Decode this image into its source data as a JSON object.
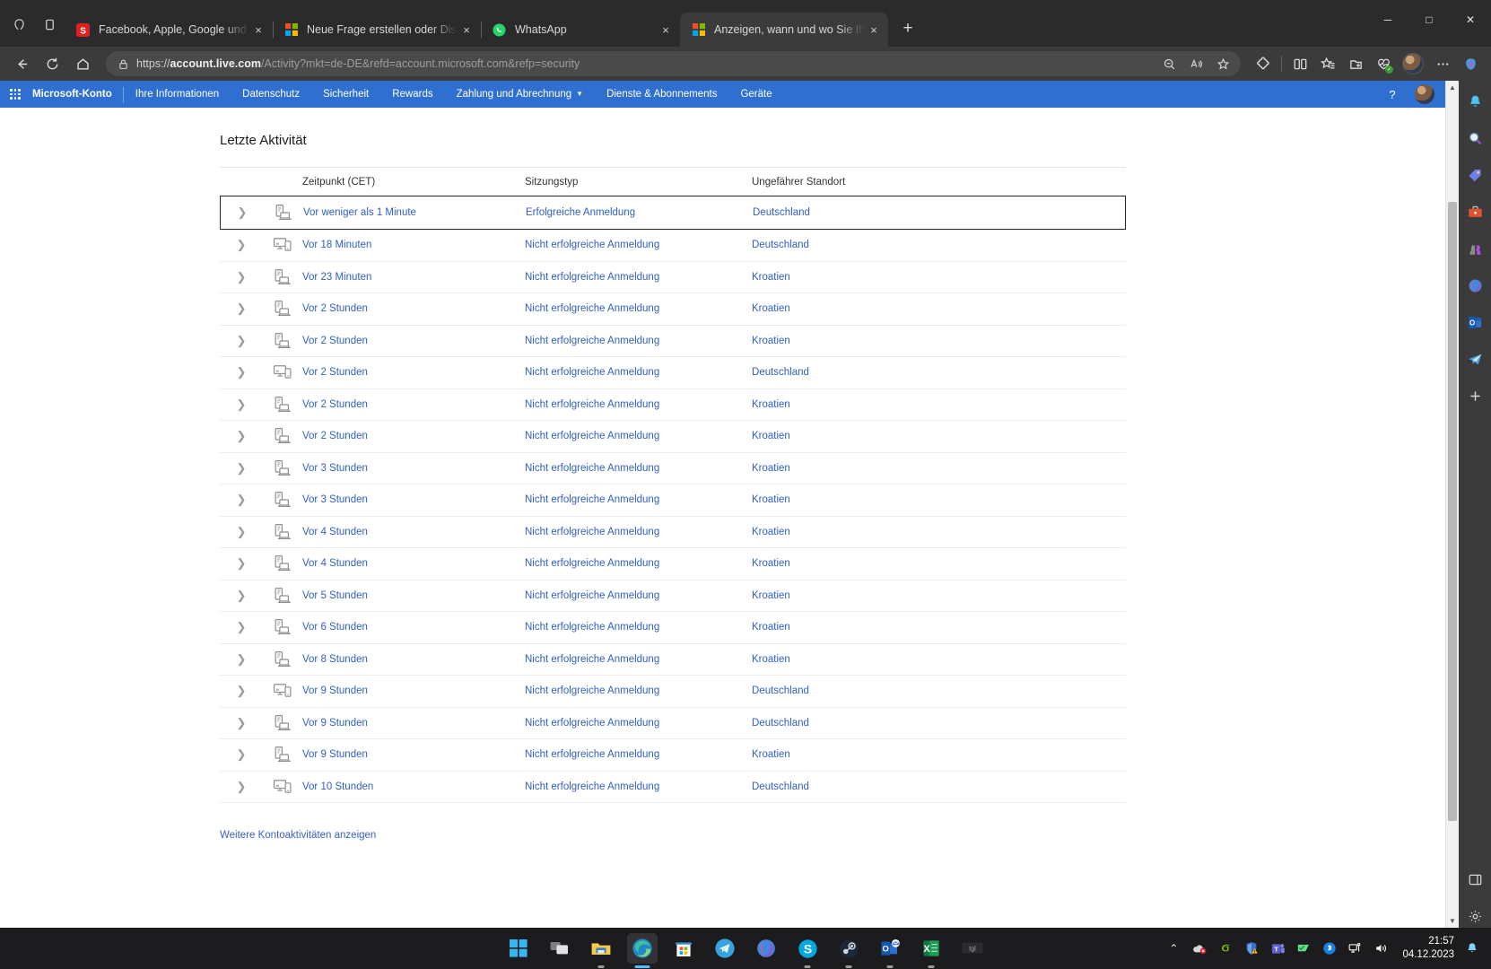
{
  "browser": {
    "tabs": [
      {
        "title": "Facebook, Apple, Google und Co",
        "favicon": "facebook-rss-icon",
        "active": false
      },
      {
        "title": "Neue Frage erstellen oder Diskus",
        "favicon": "microsoft-icon",
        "active": false
      },
      {
        "title": "WhatsApp",
        "favicon": "whatsapp-icon",
        "active": false
      },
      {
        "title": "Anzeigen, wann und wo Sie Ihr K",
        "favicon": "microsoft-icon",
        "active": true
      }
    ],
    "new_tab_label": "+",
    "close_label": "×",
    "window_controls": {
      "minimize": "─",
      "maximize": "□",
      "close": "✕"
    },
    "url": {
      "scheme": "https://",
      "domain": "account.live.com",
      "path": "/Activity?mkt=de-DE&refd=account.microsoft.com&refp=security",
      "full": "https://account.live.com/Activity?mkt=de-DE&refd=account.microsoft.com&refp=security"
    },
    "nav_icons": [
      "back-icon",
      "refresh-icon",
      "home-icon"
    ],
    "omnibox_icons": [
      "zoom-out-icon",
      "read-aloud-icon",
      "favorite-star-icon"
    ],
    "toolbar_icons": [
      "extensions-icon",
      "split-screen-icon",
      "favorites-icon",
      "collections-add-icon",
      "browser-essentials-icon",
      "profile-avatar",
      "settings-more-icon",
      "copilot-icon"
    ]
  },
  "rail": {
    "items": [
      {
        "name": "notifications-bell-icon",
        "glyph": "🔔"
      },
      {
        "name": "search-icon",
        "glyph": "🔍"
      },
      {
        "name": "shopping-tag-icon",
        "glyph": "🏷"
      },
      {
        "name": "tools-briefcase-icon",
        "glyph": "🧰"
      },
      {
        "name": "games-icon",
        "glyph": "♟"
      },
      {
        "name": "microsoft-365-icon",
        "glyph": "◐"
      },
      {
        "name": "outlook-icon",
        "glyph": "✉"
      },
      {
        "name": "telegram-icon",
        "glyph": "✈"
      },
      {
        "name": "add-sidebar-icon",
        "glyph": "＋"
      },
      {
        "name": "sidebar-toggle-icon",
        "glyph": "▣"
      },
      {
        "name": "sidebar-settings-icon",
        "glyph": "⚙"
      }
    ]
  },
  "msnav": {
    "brand": "Microsoft-Konto",
    "items": [
      {
        "label": "Ihre Informationen",
        "has_caret": false
      },
      {
        "label": "Datenschutz",
        "has_caret": false
      },
      {
        "label": "Sicherheit",
        "has_caret": false
      },
      {
        "label": "Rewards",
        "has_caret": false
      },
      {
        "label": "Zahlung und Abrechnung",
        "has_caret": true
      },
      {
        "label": "Dienste & Abonnements",
        "has_caret": false
      },
      {
        "label": "Geräte",
        "has_caret": false
      }
    ],
    "help_label": "?",
    "accent_color": "#2f6fd0"
  },
  "main": {
    "section_title": "Letzte Aktivität",
    "columns": [
      "Zeitpunkt (CET)",
      "Sitzungstyp",
      "Ungefährer Standort"
    ],
    "more_link": "Weitere Kontoaktivitäten anzeigen",
    "link_color": "#2f5fc4",
    "rows": [
      {
        "time": "Vor weniger als 1 Minute",
        "type": "Erfolgreiche Anmeldung",
        "location": "Deutschland",
        "device": "desktop-laptop-icon",
        "selected": true
      },
      {
        "time": "Vor 18 Minuten",
        "type": "Nicht erfolgreiche Anmeldung",
        "location": "Deutschland",
        "device": "monitor-phone-icon",
        "selected": false
      },
      {
        "time": "Vor 23 Minuten",
        "type": "Nicht erfolgreiche Anmeldung",
        "location": "Kroatien",
        "device": "desktop-laptop-icon",
        "selected": false
      },
      {
        "time": "Vor 2 Stunden",
        "type": "Nicht erfolgreiche Anmeldung",
        "location": "Kroatien",
        "device": "desktop-laptop-icon",
        "selected": false
      },
      {
        "time": "Vor 2 Stunden",
        "type": "Nicht erfolgreiche Anmeldung",
        "location": "Kroatien",
        "device": "desktop-laptop-icon",
        "selected": false
      },
      {
        "time": "Vor 2 Stunden",
        "type": "Nicht erfolgreiche Anmeldung",
        "location": "Deutschland",
        "device": "monitor-phone-icon",
        "selected": false
      },
      {
        "time": "Vor 2 Stunden",
        "type": "Nicht erfolgreiche Anmeldung",
        "location": "Kroatien",
        "device": "desktop-laptop-icon",
        "selected": false
      },
      {
        "time": "Vor 2 Stunden",
        "type": "Nicht erfolgreiche Anmeldung",
        "location": "Kroatien",
        "device": "desktop-laptop-icon",
        "selected": false
      },
      {
        "time": "Vor 3 Stunden",
        "type": "Nicht erfolgreiche Anmeldung",
        "location": "Kroatien",
        "device": "desktop-laptop-icon",
        "selected": false
      },
      {
        "time": "Vor 3 Stunden",
        "type": "Nicht erfolgreiche Anmeldung",
        "location": "Kroatien",
        "device": "desktop-laptop-icon",
        "selected": false
      },
      {
        "time": "Vor 4 Stunden",
        "type": "Nicht erfolgreiche Anmeldung",
        "location": "Kroatien",
        "device": "desktop-laptop-icon",
        "selected": false
      },
      {
        "time": "Vor 4 Stunden",
        "type": "Nicht erfolgreiche Anmeldung",
        "location": "Kroatien",
        "device": "desktop-laptop-icon",
        "selected": false
      },
      {
        "time": "Vor 5 Stunden",
        "type": "Nicht erfolgreiche Anmeldung",
        "location": "Kroatien",
        "device": "desktop-laptop-icon",
        "selected": false
      },
      {
        "time": "Vor 6 Stunden",
        "type": "Nicht erfolgreiche Anmeldung",
        "location": "Kroatien",
        "device": "desktop-laptop-icon",
        "selected": false
      },
      {
        "time": "Vor 8 Stunden",
        "type": "Nicht erfolgreiche Anmeldung",
        "location": "Kroatien",
        "device": "desktop-laptop-icon",
        "selected": false
      },
      {
        "time": "Vor 9 Stunden",
        "type": "Nicht erfolgreiche Anmeldung",
        "location": "Deutschland",
        "device": "monitor-phone-icon",
        "selected": false
      },
      {
        "time": "Vor 9 Stunden",
        "type": "Nicht erfolgreiche Anmeldung",
        "location": "Deutschland",
        "device": "desktop-laptop-icon",
        "selected": false
      },
      {
        "time": "Vor 9 Stunden",
        "type": "Nicht erfolgreiche Anmeldung",
        "location": "Kroatien",
        "device": "desktop-laptop-icon",
        "selected": false
      },
      {
        "time": "Vor 10 Stunden",
        "type": "Nicht erfolgreiche Anmeldung",
        "location": "Deutschland",
        "device": "monitor-phone-icon",
        "selected": false
      }
    ]
  },
  "taskbar": {
    "apps": [
      {
        "name": "start-button",
        "glyph": "start"
      },
      {
        "name": "task-view-button",
        "glyph": "taskview"
      },
      {
        "name": "file-explorer-icon",
        "glyph": "explorer"
      },
      {
        "name": "edge-browser-icon",
        "glyph": "edge",
        "active": true
      },
      {
        "name": "microsoft-store-icon",
        "glyph": "store"
      },
      {
        "name": "telegram-icon",
        "glyph": "telegram"
      },
      {
        "name": "microsoft-365-icon",
        "glyph": "m365"
      },
      {
        "name": "skype-icon",
        "glyph": "skype"
      },
      {
        "name": "steam-icon",
        "glyph": "steam"
      },
      {
        "name": "outlook-icon",
        "glyph": "outlook"
      },
      {
        "name": "excel-icon",
        "glyph": "excel"
      },
      {
        "name": "pinned-app-icon",
        "glyph": "generic"
      }
    ],
    "tray": [
      {
        "name": "show-hidden-icons-icon",
        "glyph": "⌃"
      },
      {
        "name": "onedrive-error-icon",
        "glyph": "onedrive"
      },
      {
        "name": "nvidia-icon",
        "glyph": "nvidia"
      },
      {
        "name": "windows-security-warning-icon",
        "glyph": "shield"
      },
      {
        "name": "teams-icon",
        "glyph": "teams"
      },
      {
        "name": "flag-icon",
        "glyph": "flag"
      },
      {
        "name": "bluetooth-icon",
        "glyph": "bt"
      },
      {
        "name": "network-icon",
        "glyph": "net"
      },
      {
        "name": "volume-icon",
        "glyph": "vol"
      }
    ],
    "clock": {
      "time": "21:57",
      "date": "04.12.2023"
    },
    "notification_bell": "🔔"
  }
}
